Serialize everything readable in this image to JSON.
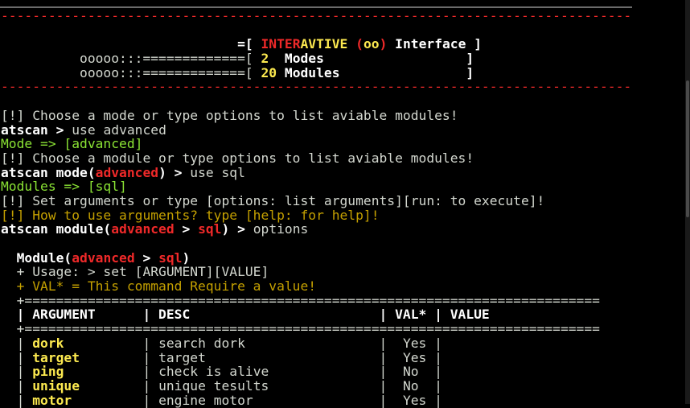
{
  "separator": "--------------------------------------------------------------------------------",
  "banner": {
    "l1_pre": "                              =[ ",
    "l1_red": "INTER",
    "l1_yellow": "AVTIVE",
    "l1_sp": " ",
    "l1_paren_open": "(",
    "l1_oo": "oo",
    "l1_paren_close": ")",
    "l1_post": " Interface ]",
    "l2_pre": "          ooooo:::=============[ ",
    "l2_num": "2",
    "l2_label": "  Modes                  ]",
    "l3_pre": "          ooooo:::=============[ ",
    "l3_num": "20",
    "l3_label": " Modules                ]"
  },
  "session": {
    "info1": "[!] Choose a mode or type options to list aviable modules!",
    "prompt1_name": "atscan",
    "prompt1_arrow": " > ",
    "prompt1_cmd": "use advanced",
    "mode_result": "Mode => [advanced]",
    "info2": "[!] Choose a module or type options to list aviable modules!",
    "prompt2_name": "atscan mode(",
    "prompt2_mode": "advanced",
    "prompt2_close": ") > ",
    "prompt2_cmd": "use sql",
    "modules_result": "Modules => [sql]",
    "info3": "[!] Set arguments or type [options: list arguments][run: to execute]!",
    "info4": "[!] How to use arguments? type [help: for help]!",
    "prompt3_name": "atscan module(",
    "prompt3_mode": "advanced",
    "prompt3_gt": " > ",
    "prompt3_module": "sql",
    "prompt3_close": ") > ",
    "prompt3_cmd": "options"
  },
  "module_block": {
    "title_pre": "  Module(",
    "title_mode": "advanced",
    "title_gt": " > ",
    "title_module": "sql",
    "title_close": ")",
    "usage": "  + Usage: > set [ARGUMENT][VALUE]",
    "val_note": "  + VAL* = This command Require a value!",
    "table_border": "  +=========================================================================",
    "header": "  | ARGUMENT      | DESC                        | VAL* | VALUE"
  },
  "table_rows": [
    {
      "pre": "  | ",
      "arg": "dork",
      "pad": "          ",
      "desc": "| search dork                 |  Yes |"
    },
    {
      "pre": "  | ",
      "arg": "target",
      "pad": "        ",
      "desc": "| target                      |  Yes |"
    },
    {
      "pre": "  | ",
      "arg": "ping",
      "pad": "          ",
      "desc": "| check is alive              |  No  |"
    },
    {
      "pre": "  | ",
      "arg": "unique",
      "pad": "        ",
      "desc": "| unique tesults              |  No  |"
    },
    {
      "pre": "  | ",
      "arg": "motor",
      "pad": "         ",
      "desc": "| engine motor                |  Yes |"
    }
  ]
}
